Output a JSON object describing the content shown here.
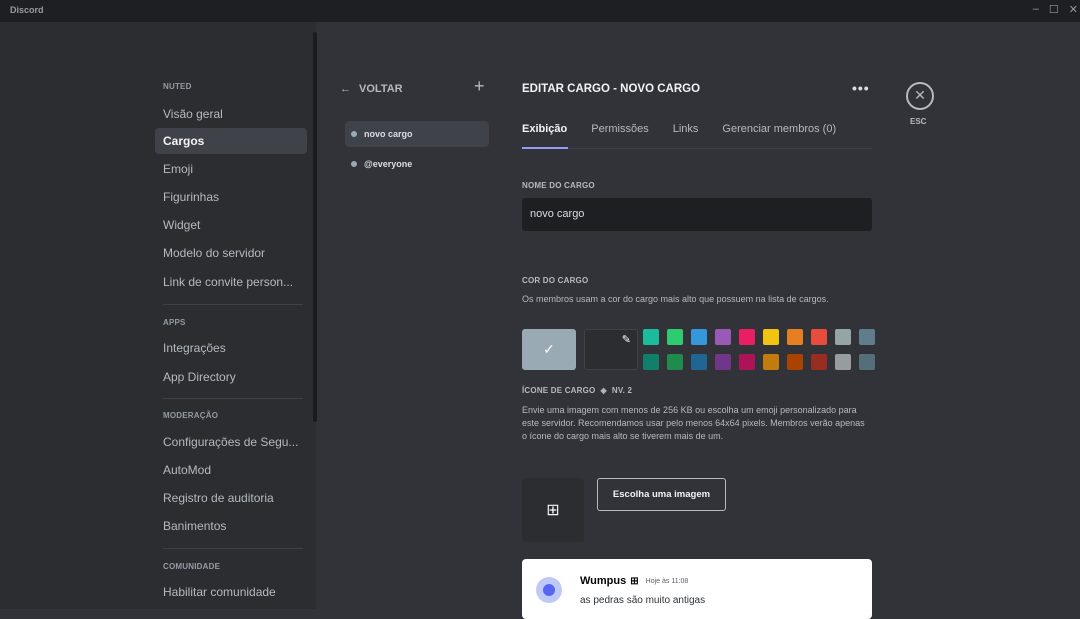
{
  "window": {
    "app_title": "Discord",
    "controls": [
      "–",
      "☐",
      "✕"
    ]
  },
  "sidebar": {
    "sections": [
      {
        "title": "NUTED",
        "items": [
          "Visão geral",
          "Cargos",
          "Emoji",
          "Figurinhas",
          "Widget",
          "Modelo do servidor",
          "Link de convite person..."
        ]
      },
      {
        "title": "APPS",
        "items": [
          "Integrações",
          "App Directory"
        ]
      },
      {
        "title": "MODERAÇÃO",
        "items": [
          "Configurações de Segu...",
          "AutoMod",
          "Registro de auditoria",
          "Banimentos"
        ]
      },
      {
        "title": "COMUNIDADE",
        "items": [
          "Habilitar comunidade"
        ]
      }
    ],
    "active_item": "Cargos"
  },
  "roles": {
    "back_label": "VOLTAR",
    "add_icon": "plus-icon",
    "items": [
      {
        "name": "novo cargo",
        "color": "#99aab5",
        "active": true
      },
      {
        "name": "@everyone",
        "color": "#99aab5",
        "active": false
      }
    ]
  },
  "editor": {
    "title": "EDITAR CARGO - NOVO CARGO",
    "more_icon": "more-icon",
    "esc_label": "ESC",
    "tabs": [
      "Exibição",
      "Permissões",
      "Links",
      "Gerenciar membros (0)"
    ],
    "active_tab": "Exibição",
    "role_name_label": "NOME DO CARGO",
    "role_name_value": "novo cargo",
    "color_label": "COR DO CARGO",
    "color_desc": "Os membros usam a cor do cargo mais alto que possuem na lista de cargos.",
    "default_color": "#99aab5",
    "palette_row1": [
      "#1abc9c",
      "#2ecc71",
      "#3498db",
      "#9b59b6",
      "#e91e63",
      "#f1c40f",
      "#e67e22",
      "#e74c3c",
      "#95a5a6",
      "#607d8b"
    ],
    "palette_row2": [
      "#11806a",
      "#1f8b4c",
      "#206694",
      "#71368a",
      "#ad1457",
      "#c27c0e",
      "#a84300",
      "#992d22",
      "#979c9f",
      "#546e7a"
    ],
    "icon_label": "ÍCONE DE CARGO",
    "icon_level": "NV. 2",
    "icon_desc": "Envie uma imagem com menos de 256 KB ou escolha um emoji personalizado para este servidor. Recomendamos usar pelo menos 64x64 pixels. Membros verão apenas o ícone do cargo mais alto se tiverem mais de um.",
    "choose_image_label": "Escolha uma imagem"
  },
  "preview": {
    "username": "Wumpus",
    "timestamp": "Hoje às 11:08",
    "message": "as pedras são muito antigas"
  }
}
